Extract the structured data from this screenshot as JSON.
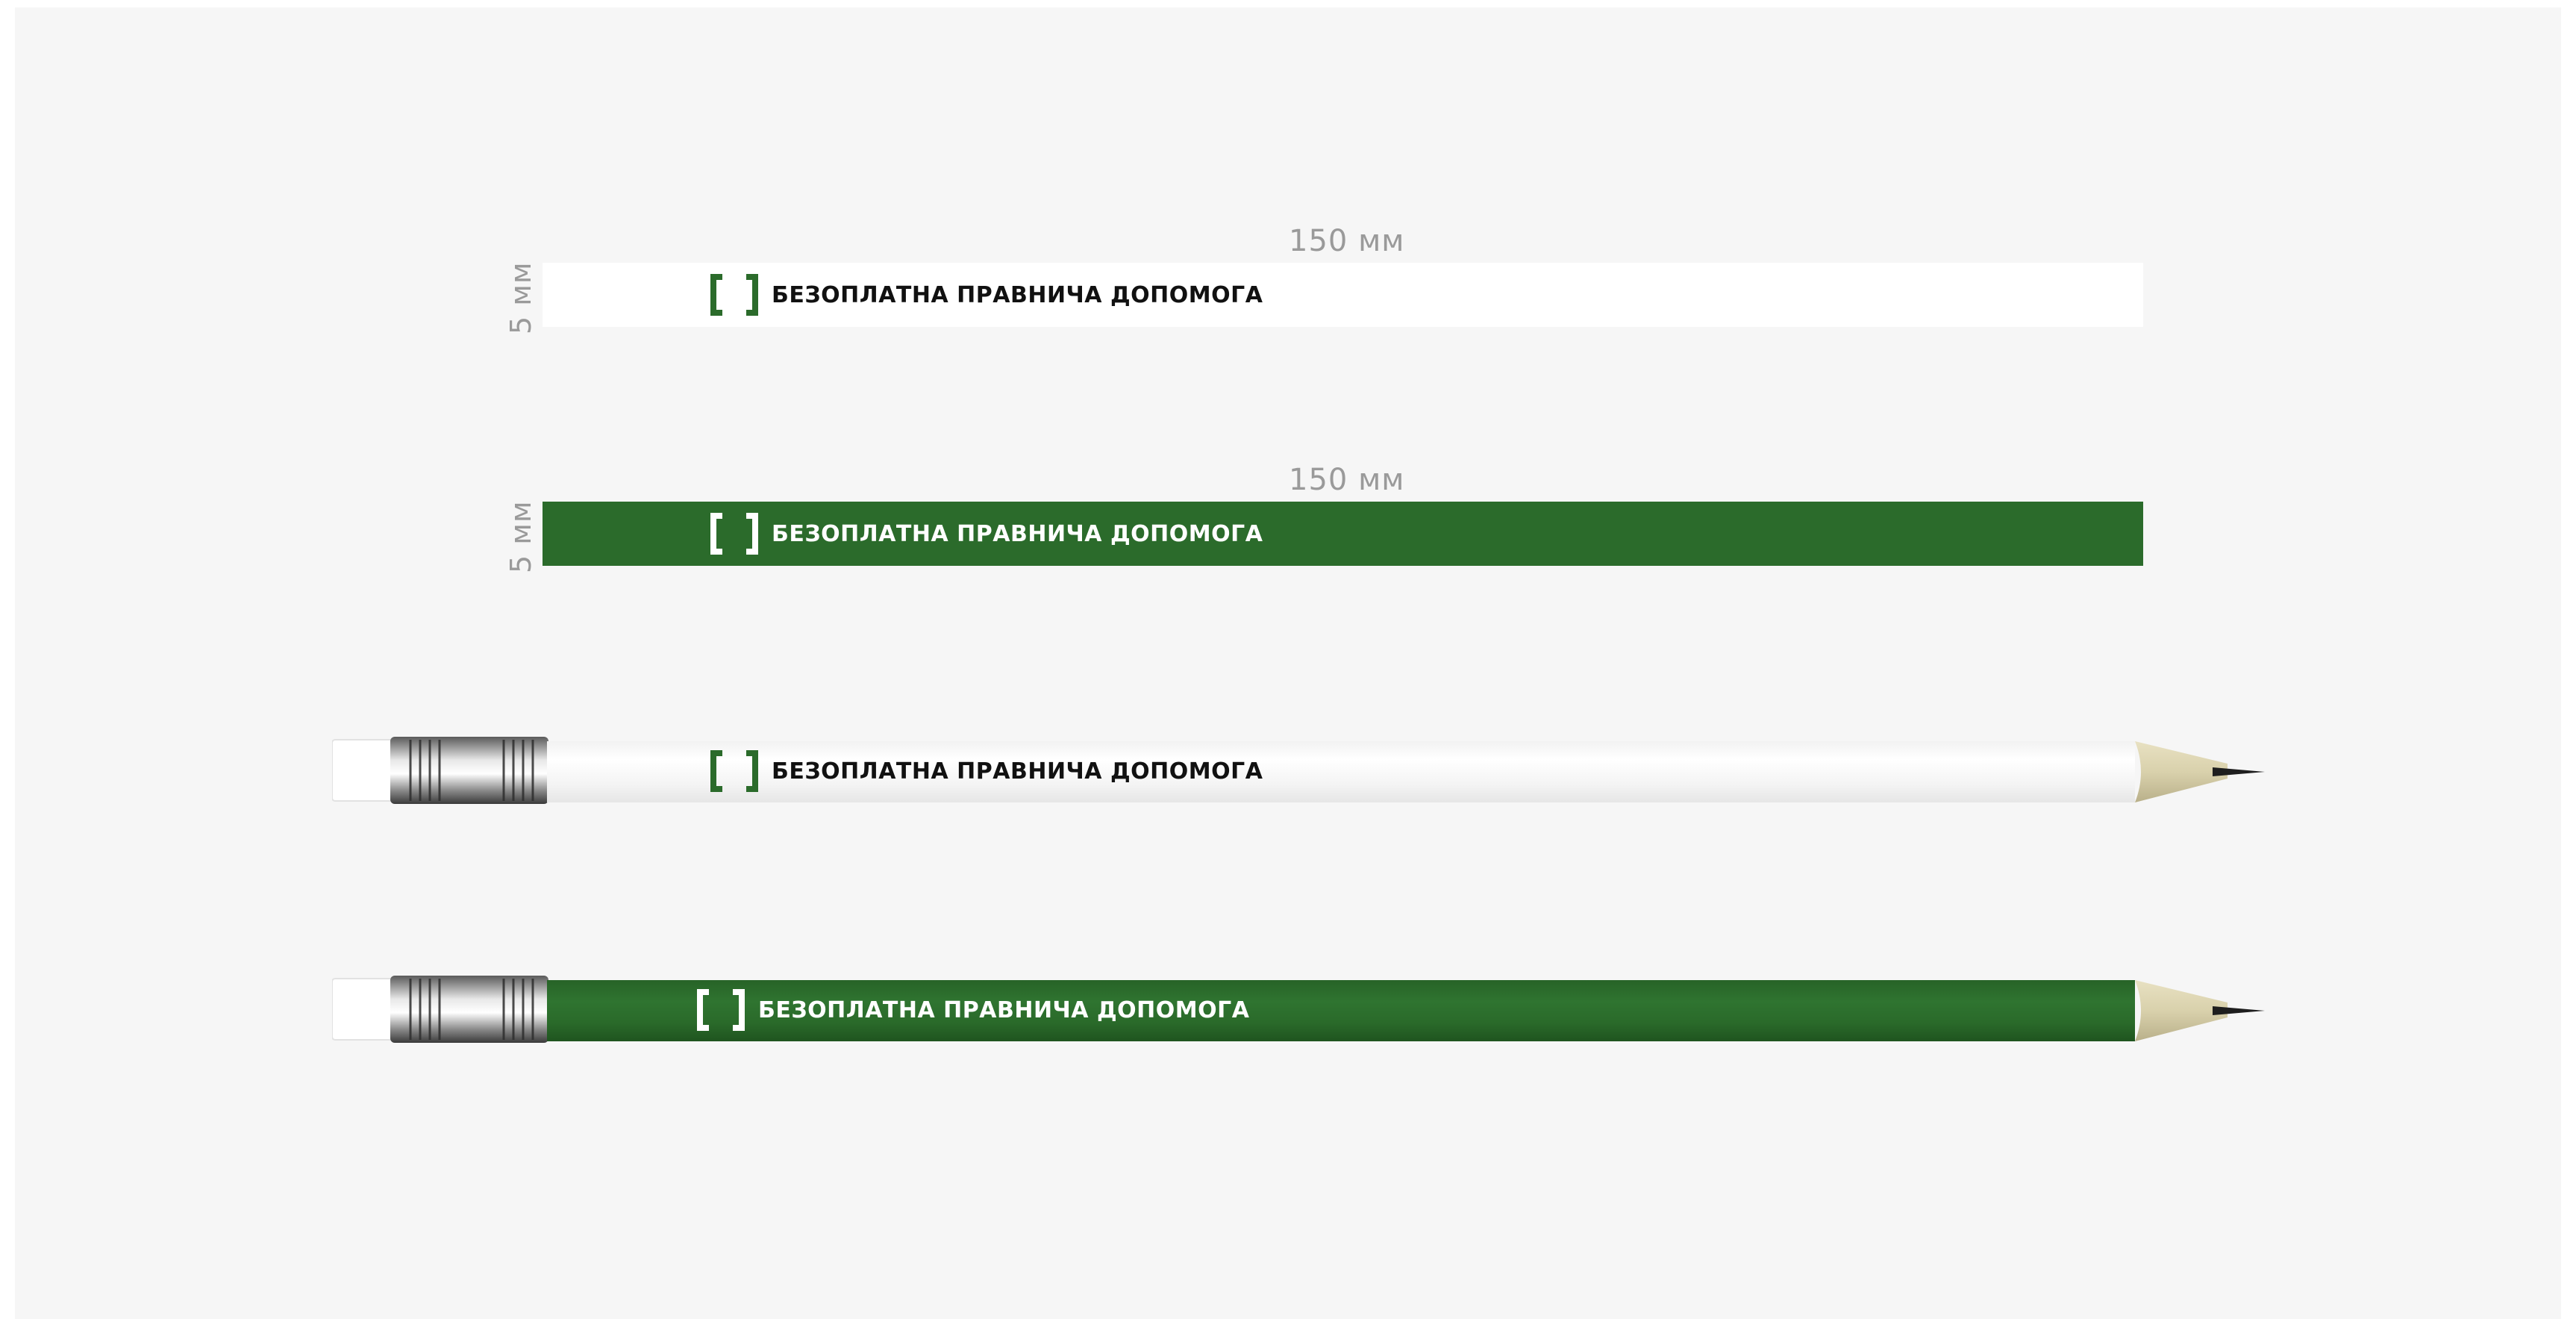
{
  "dimensions": {
    "strip_white_width": "150 мм",
    "strip_white_height": "5 мм",
    "strip_green_width": "150 мм",
    "strip_green_height": "5 мм"
  },
  "brand": {
    "text": "БЕЗОПЛАТНА ПРАВНИЧА ДОПОМОГА",
    "green": "#2b6b2b",
    "white": "#ffffff",
    "dark": "#111111"
  },
  "mockups": [
    {
      "name": "strip-white",
      "background": "#ffffff",
      "logo_text_color": "#111111",
      "bracket_color": "#2b6b2b"
    },
    {
      "name": "strip-green",
      "background": "#2b6b2b",
      "logo_text_color": "#ffffff",
      "bracket_color": "#ffffff"
    },
    {
      "name": "pencil-white",
      "background": "#ffffff",
      "logo_text_color": "#111111",
      "bracket_color": "#2b6b2b"
    },
    {
      "name": "pencil-green",
      "background": "#2b6b2b",
      "logo_text_color": "#ffffff",
      "bracket_color": "#ffffff"
    }
  ]
}
